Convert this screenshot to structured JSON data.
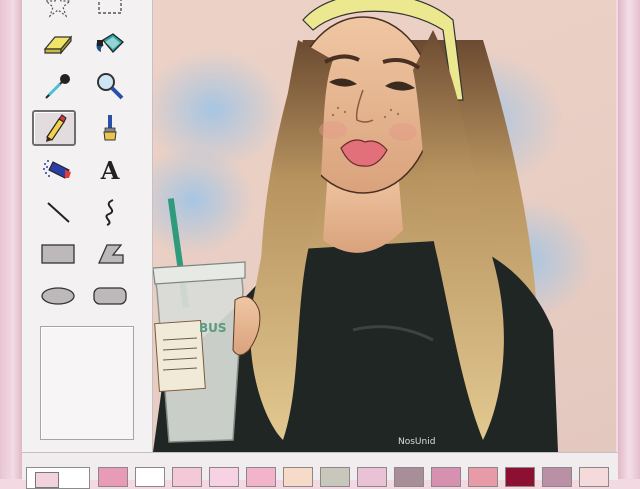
{
  "app": {
    "frame_color": "#f3d9e2",
    "toolbox_bg": "#f4f1f2"
  },
  "tools": [
    {
      "name": "free-form-select",
      "icon": "star-select-icon",
      "selected": false
    },
    {
      "name": "rectangle-select",
      "icon": "dashed-rect-icon",
      "selected": false
    },
    {
      "name": "eraser",
      "icon": "eraser-icon",
      "selected": false
    },
    {
      "name": "fill",
      "icon": "paint-bucket-icon",
      "selected": false
    },
    {
      "name": "pick-color",
      "icon": "eyedropper-icon",
      "selected": false
    },
    {
      "name": "magnifier",
      "icon": "magnifier-icon",
      "selected": false
    },
    {
      "name": "pencil",
      "icon": "pencil-icon",
      "selected": true
    },
    {
      "name": "brush",
      "icon": "brush-icon",
      "selected": false
    },
    {
      "name": "airbrush",
      "icon": "airbrush-icon",
      "selected": false
    },
    {
      "name": "text",
      "icon": "text-icon",
      "selected": false
    },
    {
      "name": "line",
      "icon": "line-icon",
      "selected": false
    },
    {
      "name": "curve",
      "icon": "curve-icon",
      "selected": false
    },
    {
      "name": "rectangle",
      "icon": "rectangle-icon",
      "selected": false
    },
    {
      "name": "polygon",
      "icon": "polygon-icon",
      "selected": false
    },
    {
      "name": "ellipse",
      "icon": "ellipse-icon",
      "selected": false
    },
    {
      "name": "rounded-rectangle",
      "icon": "rounded-rect-icon",
      "selected": false
    }
  ],
  "text_tool_glyph": "A",
  "canvas": {
    "cup_text": "BUS",
    "hoodie_text": "NosUnid"
  },
  "palette": {
    "foreground": "#f2d3dc",
    "colors": [
      "#e79bb6",
      "#ffffff",
      "#f3c9d8",
      "#f6d2e4",
      "#f2b4cb",
      "#f6dcc8",
      "#c7c8bb",
      "#e9c3d5",
      "#a88e98",
      "#d691b1",
      "#e79aa8",
      "#8c1032",
      "#ba90a7",
      "#f4dada"
    ]
  }
}
